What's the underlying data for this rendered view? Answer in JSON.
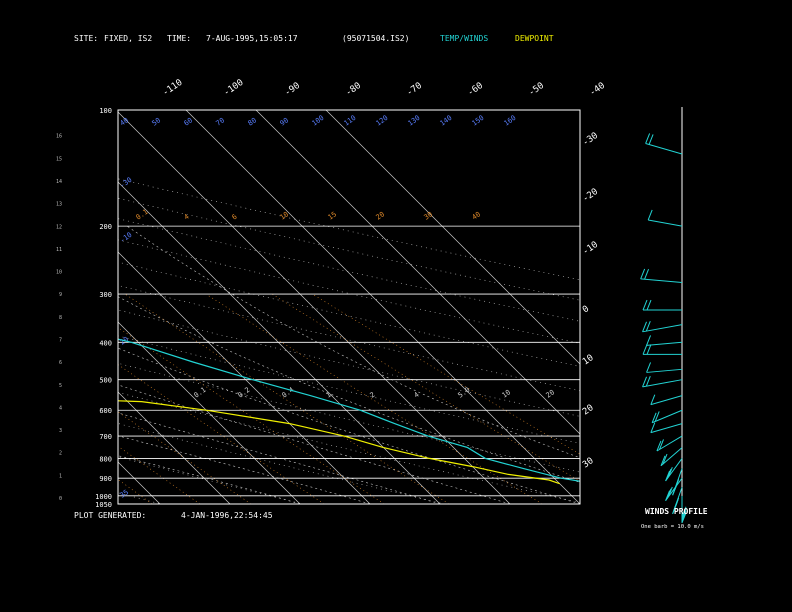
{
  "header": {
    "site_label": "SITE:",
    "site_value": "FIXED, IS2",
    "time_label": "TIME:",
    "time_value": "7-AUG-1995,15:05:17",
    "file_id": "(95071504.IS2)",
    "legend_temp": "TEMP/WINDS",
    "legend_dew": "DEWPOINT"
  },
  "footer": {
    "generated_label": "PLOT GENERATED:",
    "generated_value": "4-JAN-1996,22:54:45"
  },
  "wind_panel": {
    "title": "WINDS PROFILE",
    "note": "One barb = 10.0 m/s"
  },
  "colors": {
    "temp": "#22d3d3",
    "dew": "#f0f000",
    "text": "#ffffff",
    "mixing": "#e08a2a",
    "wet_adiabat": "#5a7fff",
    "dry_adiabat": "#c8c8c8",
    "isotherm": "#c8c8c8"
  },
  "chart_data": {
    "type": "line",
    "subtype": "skew-T log-P sounding",
    "pressure_axis": {
      "labels": [
        "100",
        "200",
        "300",
        "400",
        "500",
        "600",
        "700",
        "800",
        "900",
        "1000",
        "1050"
      ],
      "range_hpa": [
        100,
        1050
      ],
      "scale": "log"
    },
    "height_axis_km": [
      "0",
      "1",
      "2",
      "3",
      "4",
      "5",
      "6",
      "7",
      "8",
      "9",
      "10",
      "11",
      "12",
      "13",
      "14",
      "15",
      "16"
    ],
    "temperature_top_labels": [
      "-110",
      "-100",
      "-90",
      "-80",
      "-70",
      "-60",
      "-50",
      "-40"
    ],
    "temperature_right_labels": [
      "-30",
      "-20",
      "-10",
      "0",
      "10",
      "20",
      "30"
    ],
    "isotherm_range_c": [
      -130,
      40
    ],
    "dry_adiabat_labels": [
      "40",
      "50",
      "60",
      "70",
      "80",
      "90",
      "100",
      "110",
      "120",
      "130",
      "140",
      "150",
      "160"
    ],
    "wet_adiabat_labels": [
      "-30",
      "-10",
      "20",
      "35"
    ],
    "mixing_ratio_labels_200": [
      "0.1",
      "4",
      "6",
      "10",
      "15",
      "20",
      "30",
      "40"
    ],
    "mixing_ratio_labels_550": [
      "0.1",
      "0.2",
      "0.4",
      "1",
      "2",
      "4",
      "5.0",
      "10",
      "20"
    ],
    "series": [
      {
        "name": "TEMP/WINDS",
        "pressure_hpa": [
          100,
          110,
          125,
          140,
          160,
          180,
          200,
          240,
          280,
          320,
          360,
          400,
          450,
          500,
          550,
          600,
          650,
          700,
          750,
          800,
          850,
          900,
          930
        ],
        "temp_c": [
          -77,
          -77,
          -78,
          -78,
          -77,
          -74,
          -72,
          -58,
          -46,
          -37,
          -29,
          -21,
          -15,
          -9,
          -3,
          2,
          5,
          8,
          12,
          13,
          17,
          21,
          25
        ]
      },
      {
        "name": "DEWPOINT",
        "pressure_hpa": [
          100,
          120,
          140,
          160,
          180,
          200,
          240,
          280,
          300,
          320,
          330,
          360,
          400,
          430,
          460,
          480,
          500,
          510,
          520,
          540,
          560,
          570,
          600,
          650,
          700,
          750,
          800,
          840,
          880,
          910,
          930
        ],
        "dew_c": [
          -90,
          -91,
          -93,
          -96,
          -100,
          -104,
          -99,
          -92,
          -89,
          -88,
          -95,
          -86,
          -77,
          -70,
          -72,
          -63,
          -48,
          -46,
          -70,
          -40,
          -40,
          -28,
          -20,
          -10,
          -4,
          0,
          5,
          10,
          14,
          19,
          20
        ]
      }
    ],
    "winds": {
      "pressure_hpa": [
        130,
        200,
        280,
        330,
        360,
        400,
        430,
        470,
        500,
        550,
        600,
        650,
        700,
        750,
        800,
        850,
        900,
        950,
        1000
      ],
      "speed_ms": [
        20,
        10,
        20,
        15,
        20,
        10,
        15,
        10,
        20,
        10,
        15,
        10,
        15,
        20,
        30,
        40,
        30,
        40,
        40
      ],
      "direction_deg": [
        300,
        290,
        280,
        270,
        250,
        260,
        270,
        260,
        250,
        240,
        230,
        240,
        220,
        210,
        200,
        190,
        200,
        190,
        180
      ]
    }
  }
}
